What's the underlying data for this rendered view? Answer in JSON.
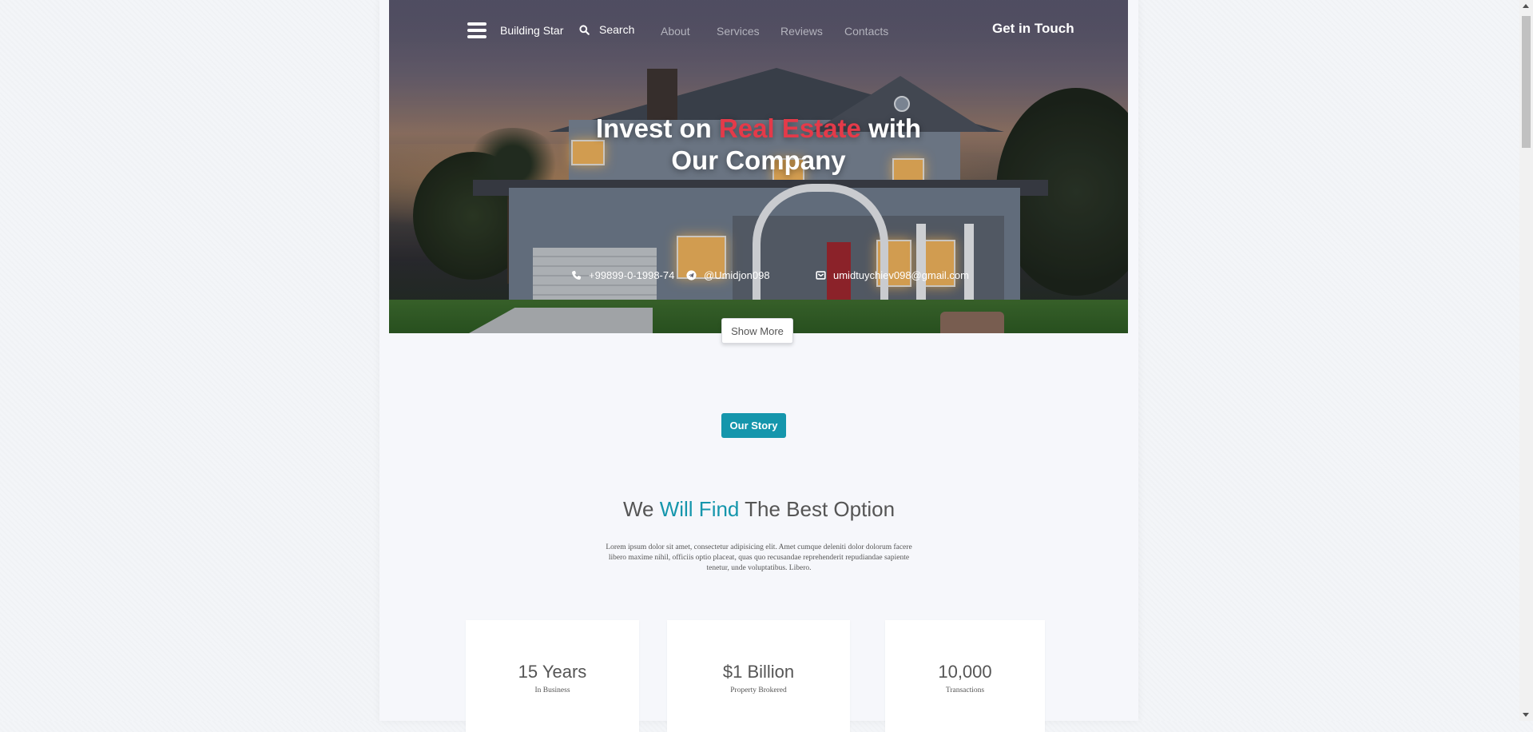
{
  "nav": {
    "brand": "Building Star",
    "search_label": "Search",
    "links": [
      "About",
      "Services",
      "Reviews",
      "Contacts"
    ],
    "cta": "Get in Touch"
  },
  "hero": {
    "headline_part1": "Invest on ",
    "headline_accent": "Real Estate",
    "headline_part2": " with",
    "headline_line2": "Our Company",
    "phone": "+99899-0-1998-74",
    "telegram": "@Umidjon098",
    "email": "umidtuychiev098@gmail.com",
    "show_more": "Show More"
  },
  "story": {
    "badge": "Our Story",
    "title_part1": "We ",
    "title_accent": "Will Find",
    "title_part2": " The Best Option",
    "description": "Lorem ipsum dolor sit amet, consectetur adipisicing elit. Amet cumque deleniti dolor dolorum facere libero maxime nihil, officiis optio placeat, quas quo recusandae reprehenderit repudiandae sapiente tenetur, unde voluptatibus. Libero."
  },
  "stats": [
    {
      "value": "15 Years",
      "label": "In Business"
    },
    {
      "value": "$1 Billion",
      "label": "Property Brokered"
    },
    {
      "value": "10,000",
      "label": "Transactions"
    }
  ],
  "colors": {
    "accent_red": "#e43a49",
    "accent_teal": "#1596ac"
  },
  "icons": [
    "menu-icon",
    "search-icon",
    "phone-icon",
    "telegram-icon",
    "email-icon"
  ]
}
